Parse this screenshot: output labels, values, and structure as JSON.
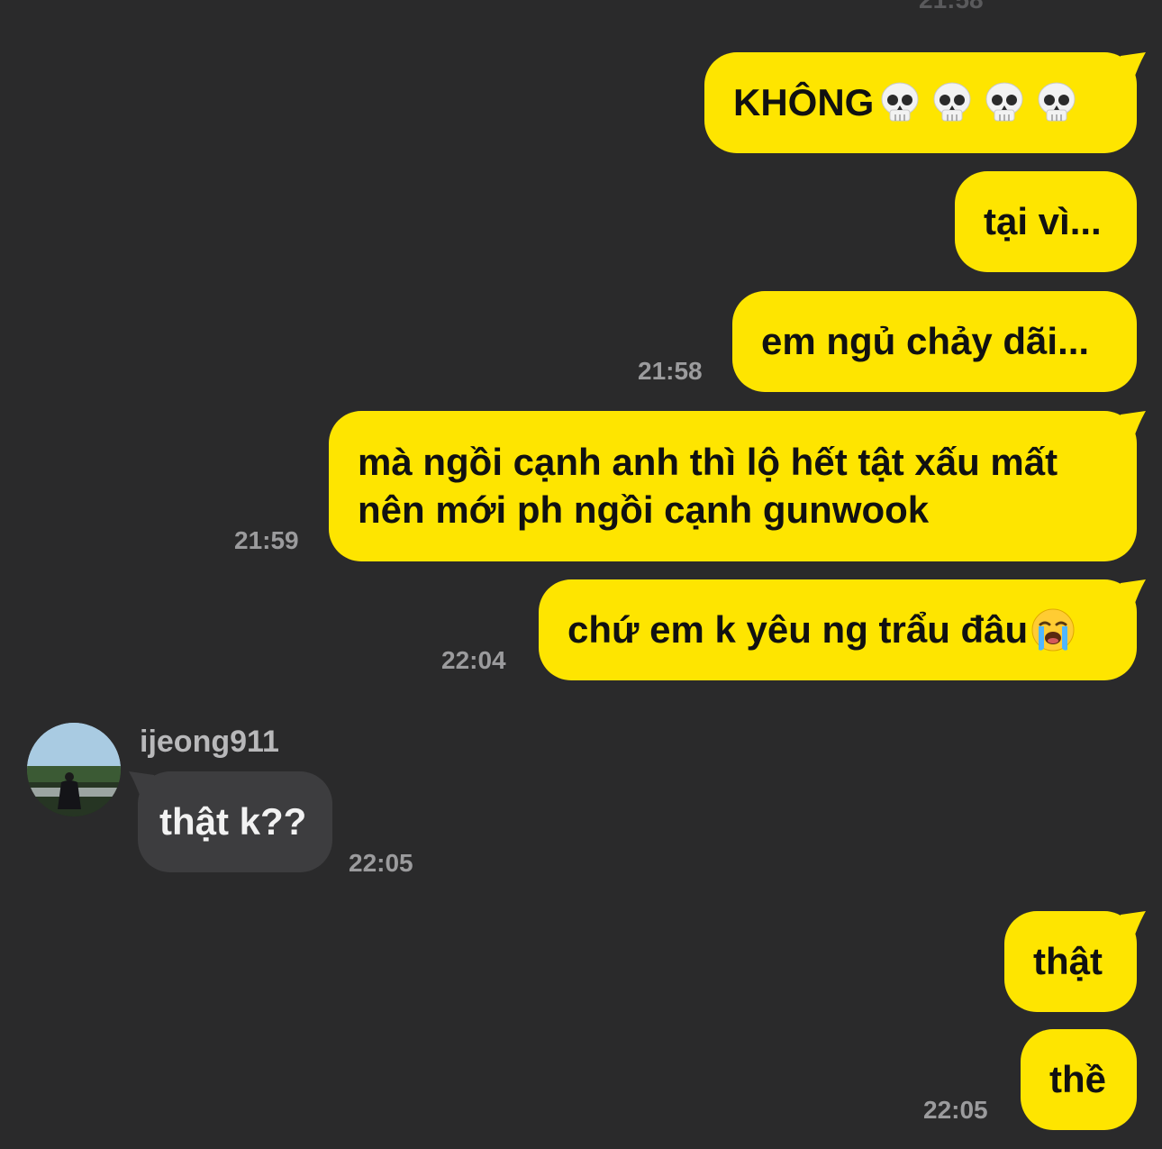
{
  "chat": {
    "top_time": "21:58",
    "messages": [
      {
        "id": "m1",
        "text": "KHÔNG",
        "emoji": "skull-x4"
      },
      {
        "id": "m2",
        "text": "tại vì..."
      },
      {
        "id": "m3",
        "text": "em ngủ chảy dãi...",
        "time": "21:58"
      },
      {
        "id": "m4",
        "line1": "mà ngồi cạnh anh thì lộ hết tật xấu mất",
        "line2": "nên mới ph ngồi cạnh gunwook",
        "time": "21:59"
      },
      {
        "id": "m5",
        "text": "chứ em k yêu ng trẩu đâu",
        "emoji": "loudly-crying-face",
        "time": "22:04"
      },
      {
        "id": "m6",
        "sender": "ijeong911",
        "text": "thật k??",
        "time": "22:05"
      },
      {
        "id": "m7",
        "text": "thật"
      },
      {
        "id": "m8",
        "text": "thề",
        "time": "22:05"
      }
    ]
  },
  "colors": {
    "background": "#2a2a2b",
    "my_bubble": "#fee500",
    "their_bubble": "#3d3d3f",
    "timestamp": "#9b9b9d"
  }
}
